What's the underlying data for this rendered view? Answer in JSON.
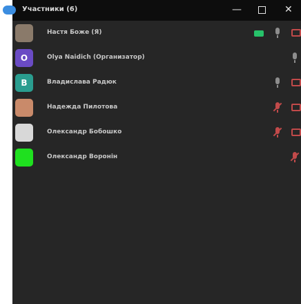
{
  "window": {
    "title": "Участники (6)",
    "min_glyph": "—",
    "close_glyph": "✕"
  },
  "participants": [
    {
      "name": "Настя Боже (Я)",
      "avatar": "photo",
      "avatar_color": "#8a7a6a",
      "mic": "on",
      "camera": "on"
    },
    {
      "name": "Olya Naidich (Организатор)",
      "avatar": "O",
      "avatar_color": "#6a4bc4",
      "mic": "on",
      "camera": "none"
    },
    {
      "name": "Владислава Радюк",
      "avatar": "В",
      "avatar_color": "#2a9d8f",
      "mic": "on",
      "camera": "off"
    },
    {
      "name": "Надежда Пилотова",
      "avatar": "photo",
      "avatar_color": "#c98a6a",
      "mic": "off",
      "camera": "off"
    },
    {
      "name": "Олександр Бобошко",
      "avatar": "photo",
      "avatar_color": "#d8d8d8",
      "mic": "off",
      "camera": "off"
    },
    {
      "name": "Олександр Воронін",
      "avatar": "",
      "avatar_color": "#1fe01f",
      "mic": "off",
      "camera": "none"
    }
  ]
}
